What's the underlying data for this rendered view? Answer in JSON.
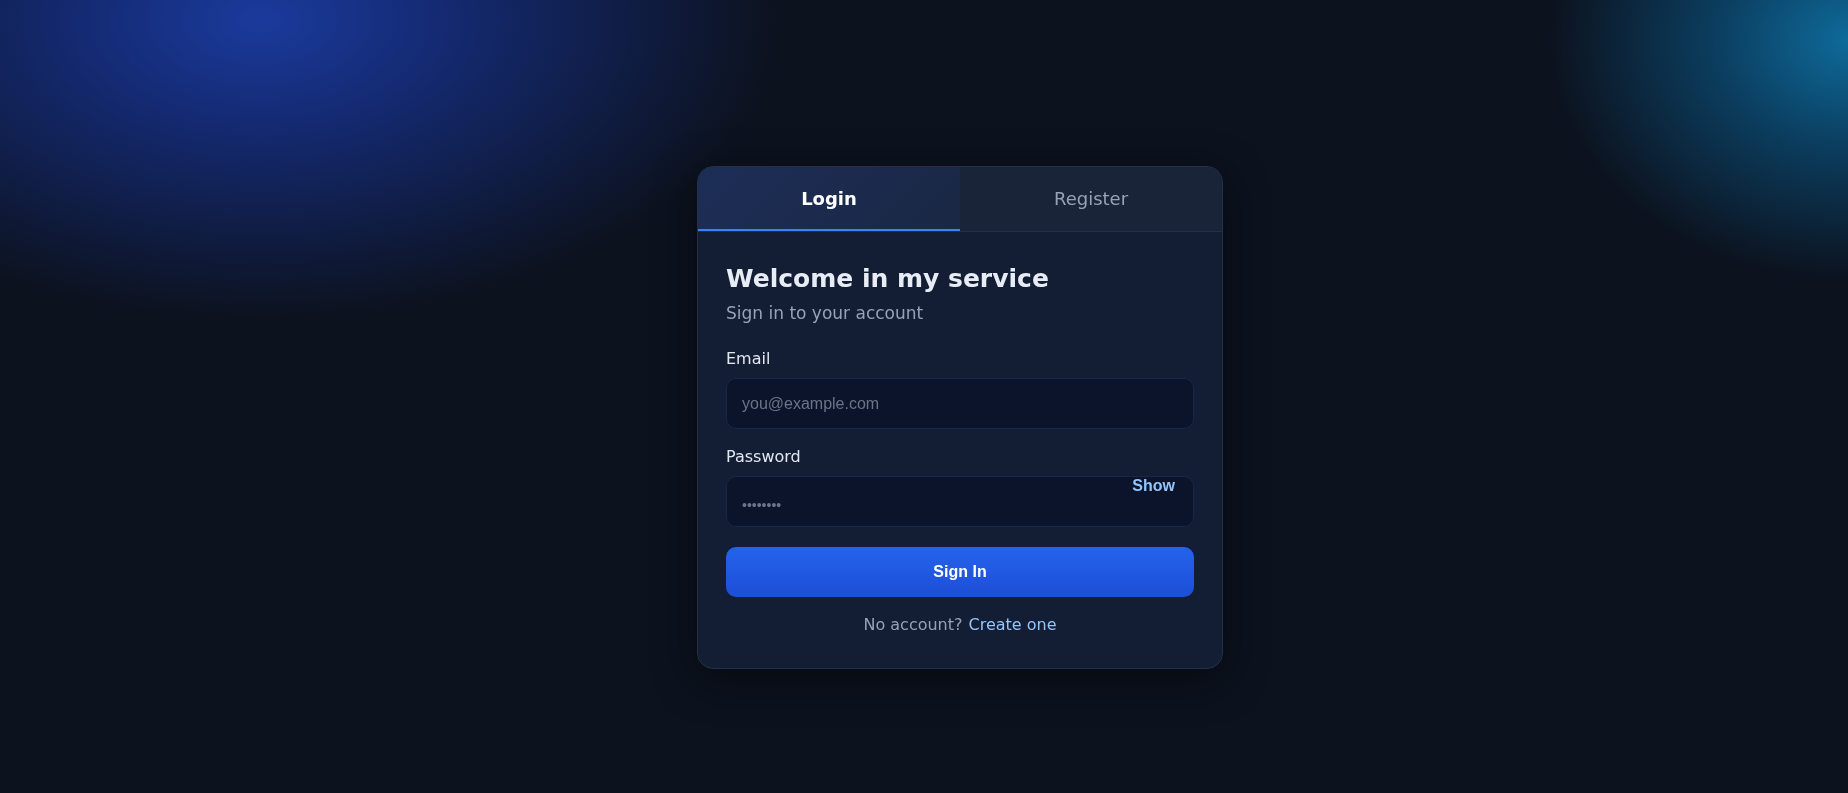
{
  "tabs": [
    {
      "label": "Login",
      "selected": true
    },
    {
      "label": "Register",
      "selected": false
    }
  ],
  "title": "Welcome in my service",
  "subtitle": "Sign in to your account",
  "fields": [
    {
      "label": "Email",
      "placeholder": "you@example.com",
      "kind": "text"
    },
    {
      "label": "Password",
      "placeholder": "••••••••",
      "kind": "password",
      "toggle": "Show"
    }
  ],
  "submit": "Sign In",
  "footer": {
    "text": "No account?",
    "link": "Create one"
  }
}
